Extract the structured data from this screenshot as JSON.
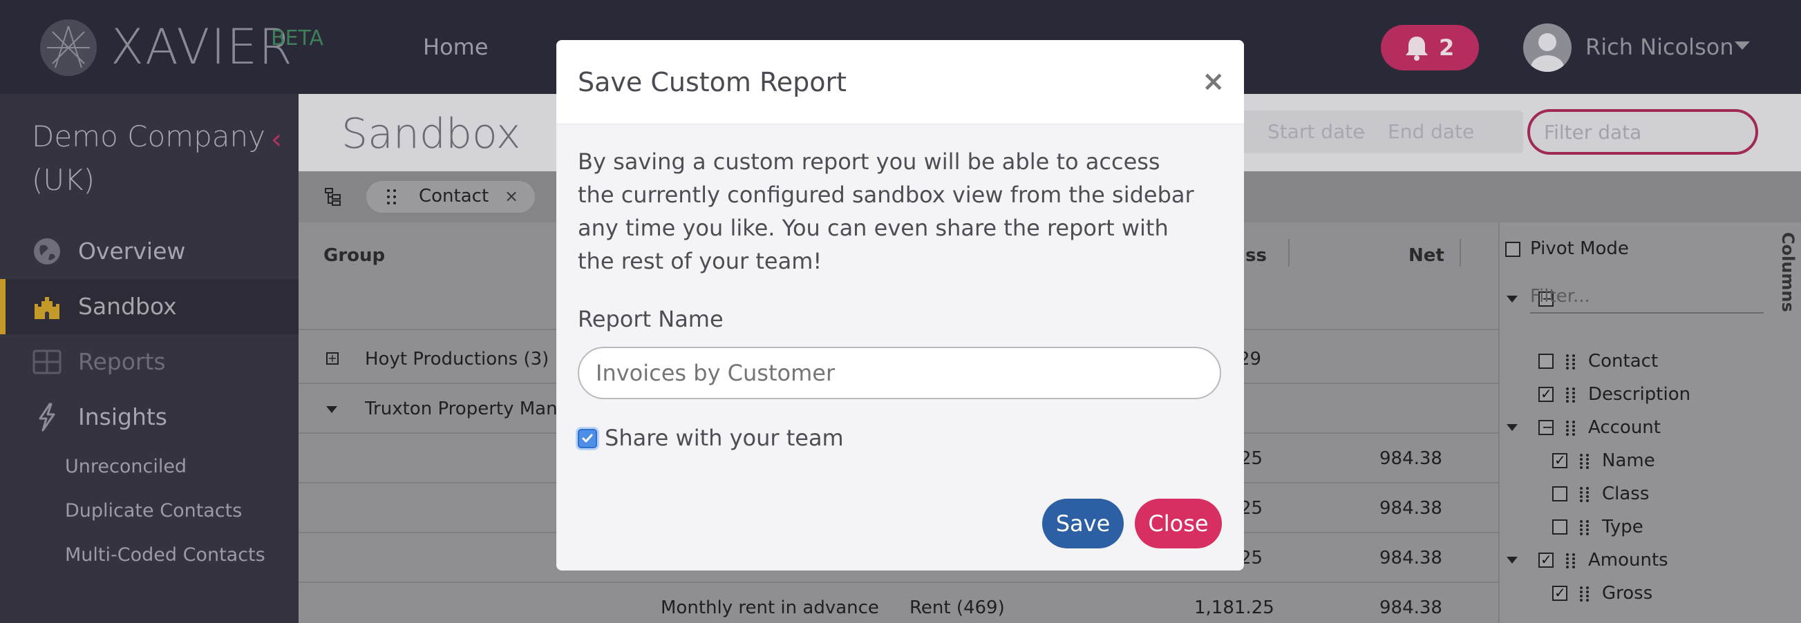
{
  "topbar": {
    "logo_text": "XAVIER",
    "beta": "BETA",
    "nav_home": "Home",
    "notifications_count": "2",
    "user_name": "Rich Nicolson"
  },
  "sidebar": {
    "company": "Demo Company (UK)",
    "items": [
      {
        "label": "Overview",
        "icon": "globe-icon"
      },
      {
        "label": "Sandbox",
        "icon": "castle-icon"
      },
      {
        "label": "Reports",
        "icon": "grid-icon"
      },
      {
        "label": "Insights",
        "icon": "bolt-icon"
      }
    ],
    "sub_items": [
      "Unreconciled",
      "Duplicate Contacts",
      "Multi-Coded Contacts"
    ]
  },
  "content": {
    "title": "Sandbox",
    "start_date_placeholder": "Start date",
    "date_separator": "-",
    "end_date_placeholder": "End date",
    "filter_placeholder": "Filter data",
    "group_chip": "Contact",
    "group_chip_remove": "×"
  },
  "grid": {
    "headers": {
      "group": "Group",
      "gross": "ss",
      "net": "Net"
    },
    "rows": [
      {
        "group": "Hoyt Productions (3)",
        "gross": "29",
        "net": ""
      },
      {
        "group": "Truxton Property Manag",
        "gross": "",
        "net": ""
      },
      {
        "group": "",
        "gross": "25",
        "net": "984.38"
      },
      {
        "group": "",
        "gross": "25",
        "net": "984.38"
      },
      {
        "group": "",
        "gross": "25",
        "net": "984.38"
      },
      {
        "group": "",
        "description": "Monthly rent in advance",
        "account": "Rent (469)",
        "gross": "1,181.25",
        "net": "984.38"
      }
    ]
  },
  "columns_panel": {
    "tab_label": "Columns",
    "pivot_mode": "Pivot Mode",
    "filter_placeholder": "Filter...",
    "items": [
      {
        "label": "Contact",
        "checked": false
      },
      {
        "label": "Description",
        "checked": true
      },
      {
        "label": "Account",
        "checked": "partial"
      },
      {
        "label": "Name",
        "checked": true
      },
      {
        "label": "Class",
        "checked": false
      },
      {
        "label": "Type",
        "checked": false
      },
      {
        "label": "Amounts",
        "checked": true
      },
      {
        "label": "Gross",
        "checked": true
      }
    ]
  },
  "modal": {
    "title": "Save Custom Report",
    "close_symbol": "×",
    "description": "By saving a custom report you will be able to access the currently configured sandbox view from the sidebar any time you like. You can even share the report with the rest of your team!",
    "report_name_label": "Report Name",
    "report_name_placeholder": "Invoices by Customer",
    "share_label": "Share with your team",
    "share_checked": true,
    "save_label": "Save",
    "close_label": "Close"
  },
  "colors": {
    "topbar": "#2a2937",
    "sidebar": "#34333f",
    "accent_pink": "#d72f62",
    "save_blue": "#2c5fa3",
    "active_gold": "#c39a27"
  }
}
